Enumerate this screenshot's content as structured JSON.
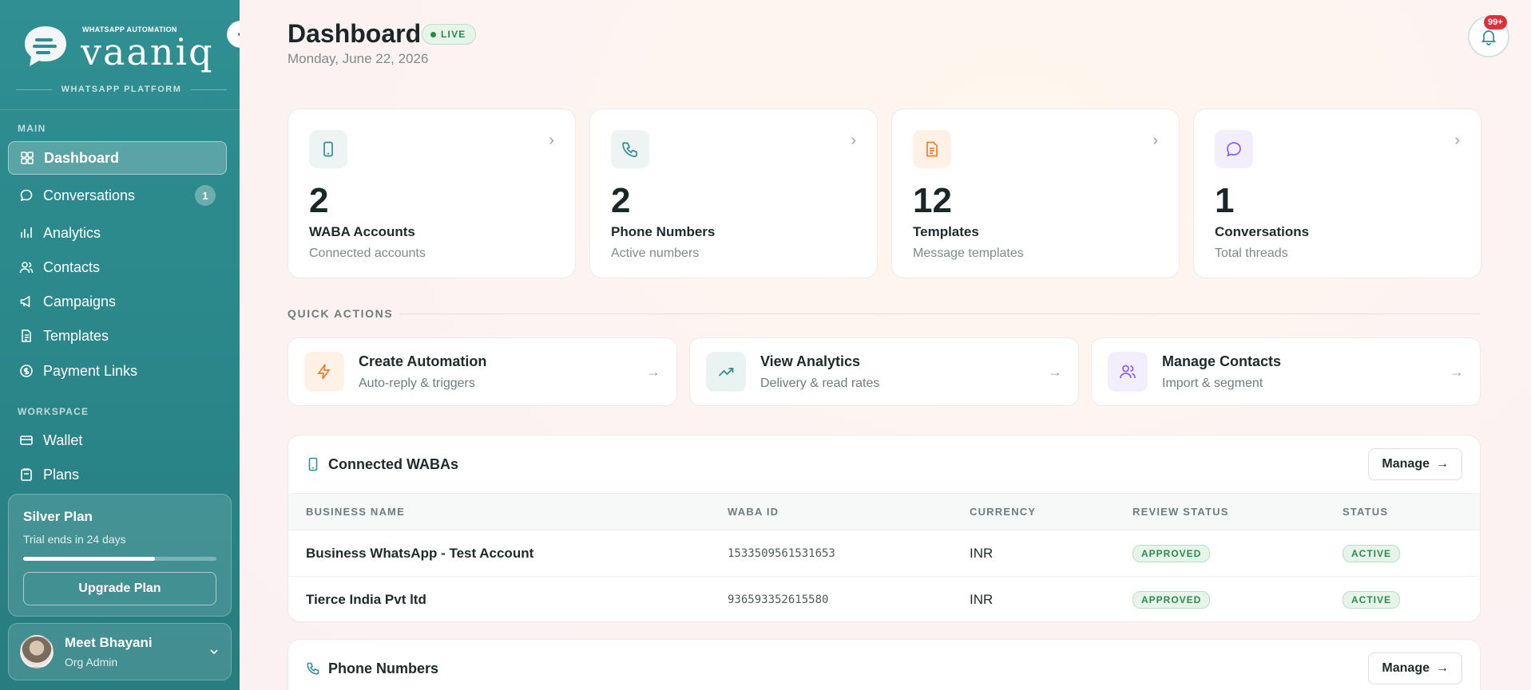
{
  "sidebar": {
    "brand": {
      "small": "WHATSAPP AUTOMATION",
      "name": "vaaniq",
      "tagline": "WHATSAPP PLATFORM"
    },
    "sections": {
      "main": "MAIN",
      "workspace": "WORKSPACE"
    },
    "items": [
      {
        "label": "Dashboard",
        "icon": "grid-icon",
        "active": true
      },
      {
        "label": "Conversations",
        "icon": "chat-icon",
        "badge": "1"
      },
      {
        "label": "Analytics",
        "icon": "bar-chart-icon"
      },
      {
        "label": "Contacts",
        "icon": "users-icon"
      },
      {
        "label": "Campaigns",
        "icon": "megaphone-icon"
      },
      {
        "label": "Templates",
        "icon": "document-icon"
      },
      {
        "label": "Payment Links",
        "icon": "coin-icon"
      },
      {
        "label": "Wallet",
        "icon": "wallet-icon"
      },
      {
        "label": "Plans",
        "icon": "clipboard-icon"
      }
    ],
    "plan": {
      "title": "Silver Plan",
      "subtitle": "Trial ends in 24 days",
      "progress": 0.68,
      "button": "Upgrade Plan"
    },
    "user": {
      "name": "Meet Bhayani",
      "role": "Org Admin"
    }
  },
  "header": {
    "title": "Dashboard",
    "live": "LIVE",
    "date": "Monday, June 22, 2026",
    "notifications": "99+"
  },
  "stats": [
    {
      "value": "2",
      "label": "WABA Accounts",
      "sub": "Connected accounts",
      "icon": "phone-device-icon"
    },
    {
      "value": "2",
      "label": "Phone Numbers",
      "sub": "Active numbers",
      "icon": "phone-call-icon"
    },
    {
      "value": "12",
      "label": "Templates",
      "sub": "Message templates",
      "icon": "document-icon"
    },
    {
      "value": "1",
      "label": "Conversations",
      "sub": "Total threads",
      "icon": "chat-icon"
    }
  ],
  "quick_actions": {
    "label": "QUICK ACTIONS",
    "items": [
      {
        "title": "Create Automation",
        "sub": "Auto-reply & triggers",
        "icon": "lightning-icon"
      },
      {
        "title": "View Analytics",
        "sub": "Delivery & read rates",
        "icon": "trend-up-icon"
      },
      {
        "title": "Manage Contacts",
        "sub": "Import & segment",
        "icon": "users-icon"
      }
    ]
  },
  "wabas": {
    "title": "Connected WABAs",
    "manage": "Manage",
    "columns": [
      "BUSINESS NAME",
      "WABA ID",
      "CURRENCY",
      "REVIEW STATUS",
      "STATUS"
    ],
    "rows": [
      {
        "name": "Business WhatsApp - Test Account",
        "id": "1533509561531653",
        "currency": "INR",
        "review": "APPROVED",
        "status": "ACTIVE"
      },
      {
        "name": "Tierce India Pvt ltd",
        "id": "936593352615580",
        "currency": "INR",
        "review": "APPROVED",
        "status": "ACTIVE"
      }
    ]
  },
  "phones": {
    "title": "Phone Numbers",
    "manage": "Manage"
  },
  "colors": {
    "sidebar": "#2a8689",
    "accent": "#2f8f92",
    "success": "#2b8a4e",
    "danger": "#d9333a"
  }
}
